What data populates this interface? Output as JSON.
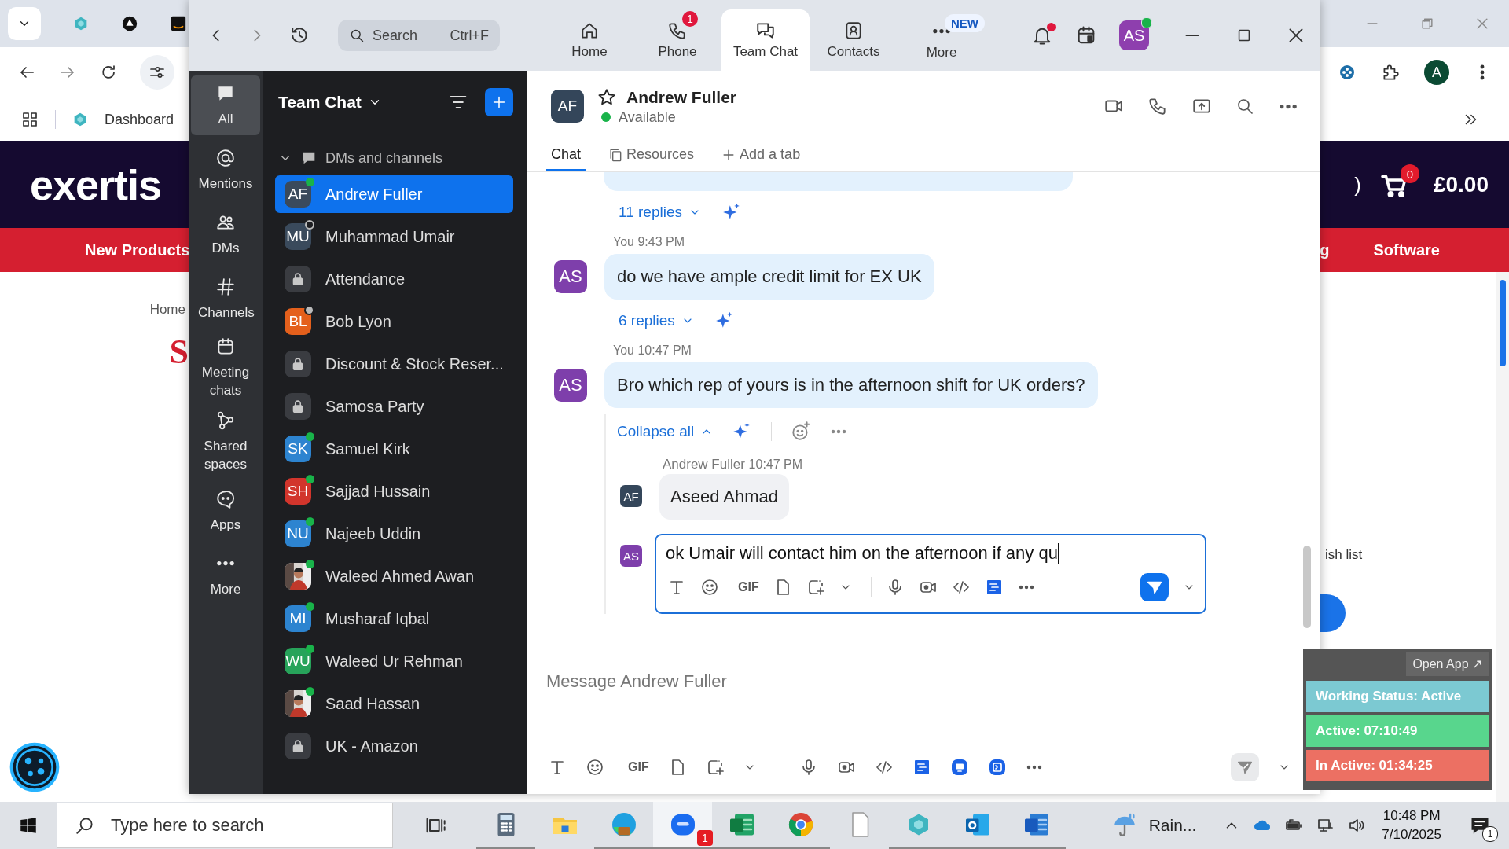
{
  "browser": {
    "profile_initial": "A",
    "bookmark": "Dashboard",
    "site": {
      "logo": "exertis",
      "header_fragment": ")",
      "cart_count": "0",
      "cart_total": "£0.00",
      "nav_left": [
        "New Products"
      ],
      "nav_right": [
        "g",
        "Software"
      ],
      "breadcrumb": "Home",
      "heading_fragment": "S",
      "wishlist_fragment": "ish list"
    }
  },
  "zoom": {
    "search": {
      "placeholder": "Search",
      "shortcut": "Ctrl+F"
    },
    "tabs": [
      {
        "label": "Home",
        "selected": false
      },
      {
        "label": "Phone",
        "selected": false,
        "badge": "1"
      },
      {
        "label": "Team Chat",
        "selected": true
      },
      {
        "label": "Contacts",
        "selected": false
      },
      {
        "label": "More",
        "selected": false,
        "tag": "NEW"
      }
    ],
    "notifications_unread": true,
    "user": {
      "initials": "AS",
      "online": true
    },
    "rail": [
      {
        "label": "All",
        "selected": true
      },
      {
        "label": "Mentions",
        "selected": false
      },
      {
        "label": "DMs",
        "selected": false
      },
      {
        "label": "Channels",
        "selected": false
      },
      {
        "label": "Meeting chats",
        "selected": false
      },
      {
        "label": "Shared spaces",
        "selected": false
      },
      {
        "label": "Apps",
        "selected": false
      },
      {
        "label": "More",
        "selected": false
      }
    ],
    "list": {
      "title": "Team Chat",
      "section": {
        "label": "DMs and channels",
        "expanded": true
      },
      "items": [
        {
          "name": "Andrew Fuller",
          "kind": "person",
          "initials": "AF",
          "color": "#3a4a5c",
          "online": true,
          "away": false,
          "selected": true
        },
        {
          "name": "Muhammad Umair",
          "kind": "person",
          "initials": "MU",
          "color": "#3a4a5c",
          "online": false,
          "away": false,
          "selected": false
        },
        {
          "name": "Attendance",
          "kind": "channel",
          "selected": false
        },
        {
          "name": "Bob Lyon",
          "kind": "person",
          "initials": "BL",
          "color": "#e4601c",
          "online": false,
          "away": true,
          "selected": false
        },
        {
          "name": "Discount & Stock Reser...",
          "kind": "channel",
          "selected": false
        },
        {
          "name": "Samosa Party",
          "kind": "channel",
          "selected": false
        },
        {
          "name": "Samuel Kirk",
          "kind": "person",
          "initials": "SK",
          "color": "#2d84d0",
          "online": true,
          "away": false,
          "selected": false
        },
        {
          "name": "Sajjad Hussain",
          "kind": "person",
          "initials": "SH",
          "color": "#d2352c",
          "online": true,
          "away": false,
          "selected": false
        },
        {
          "name": "Najeeb Uddin",
          "kind": "person",
          "initials": "NU",
          "color": "#2d84d0",
          "online": true,
          "away": false,
          "selected": false
        },
        {
          "name": "Waleed Ahmed Awan",
          "online": true,
          "away": false,
          "selected": false
        },
        {
          "name": "Musharaf Iqbal",
          "kind": "person",
          "initials": "MI",
          "color": "#2d84d0",
          "online": true,
          "away": false,
          "selected": false
        },
        {
          "name": "Waleed Ur Rehman",
          "kind": "person",
          "initials": "WU",
          "color": "#27a35a",
          "online": true,
          "away": false,
          "selected": false
        },
        {
          "name": "Saad Hassan",
          "online": true,
          "away": false,
          "selected": false
        },
        {
          "name": "UK - Amazon",
          "kind": "channel",
          "selected": false
        }
      ]
    },
    "chat": {
      "contact": {
        "initials": "AF",
        "name": "Andrew Fuller",
        "status": "Available",
        "starred": false
      },
      "tabs": [
        {
          "label": "Chat",
          "kind": "chat",
          "selected": true
        },
        {
          "label": "Resources",
          "kind": "resources",
          "selected": false
        },
        {
          "label": "Add a tab",
          "kind": "add",
          "selected": false
        }
      ],
      "messages": [
        {
          "kind": "replies",
          "label": "11 replies"
        },
        {
          "kind": "message",
          "author": "You",
          "time": "9:43 PM",
          "initials": "AS",
          "text": "do we have ample credit limit for EX UK"
        },
        {
          "kind": "replies",
          "label": "6 replies"
        },
        {
          "kind": "message",
          "author": "You",
          "time": "10:47 PM",
          "initials": "AS",
          "text": "Bro which rep of yours is in the afternoon shift for UK orders?"
        },
        {
          "kind": "thread",
          "collapse": "Collapse all",
          "replies": [
            {
              "author": "Andrew Fuller",
              "time": "10:47 PM",
              "initials": "AF",
              "text": "Aseed Ahmad"
            }
          ],
          "draft": {
            "initials": "AS",
            "value": "ok Umair will contact him on the afternoon if any qu",
            "send_enabled": true,
            "toolbar": [
              {
                "kind": "format"
              },
              {
                "kind": "emoji"
              },
              {
                "kind": "gif",
                "label": "GIF"
              },
              {
                "kind": "file"
              },
              {
                "kind": "screenshot"
              },
              {
                "kind": "mic"
              },
              {
                "kind": "video"
              },
              {
                "kind": "code"
              },
              {
                "kind": "doc"
              },
              {
                "kind": "more"
              }
            ]
          }
        }
      ]
    },
    "composer": {
      "placeholder": "Message Andrew Fuller",
      "send_enabled": false,
      "toolbar": [
        {
          "kind": "format"
        },
        {
          "kind": "emoji"
        },
        {
          "kind": "gif",
          "label": "GIF"
        },
        {
          "kind": "file"
        },
        {
          "kind": "screenshot"
        },
        {
          "kind": "mic"
        },
        {
          "kind": "video"
        },
        {
          "kind": "code"
        },
        {
          "kind": "doc"
        },
        {
          "kind": "whiteboard"
        },
        {
          "kind": "app"
        },
        {
          "kind": "more"
        }
      ]
    }
  },
  "widget": {
    "open_app": "Open App ↗",
    "rows": [
      {
        "text": "Working Status: Active",
        "color": "#7cc9d2"
      },
      {
        "text": "Active: 07:10:49",
        "color": "#58d68d"
      },
      {
        "text": "In Active: 01:34:25",
        "color": "#ec7063"
      }
    ]
  },
  "taskbar": {
    "search_placeholder": "Type here to search",
    "apps": [
      {
        "kind": "calculator",
        "running": true,
        "active": false
      },
      {
        "kind": "folder",
        "running": false,
        "active": false
      },
      {
        "kind": "edge",
        "running": true,
        "active": false
      },
      {
        "kind": "zoom",
        "running": true,
        "active": true,
        "badge": "1"
      },
      {
        "kind": "excel",
        "running": true,
        "active": false
      },
      {
        "kind": "chrome",
        "running": true,
        "active": false
      },
      {
        "kind": "file",
        "running": false,
        "active": false
      },
      {
        "kind": "hex",
        "running": true,
        "active": false
      },
      {
        "kind": "outlook",
        "running": true,
        "active": false
      },
      {
        "kind": "word",
        "running": true,
        "active": false
      }
    ],
    "weather": "Rain...",
    "time": "10:48 PM",
    "date": "7/10/2025",
    "notifications": "1"
  }
}
